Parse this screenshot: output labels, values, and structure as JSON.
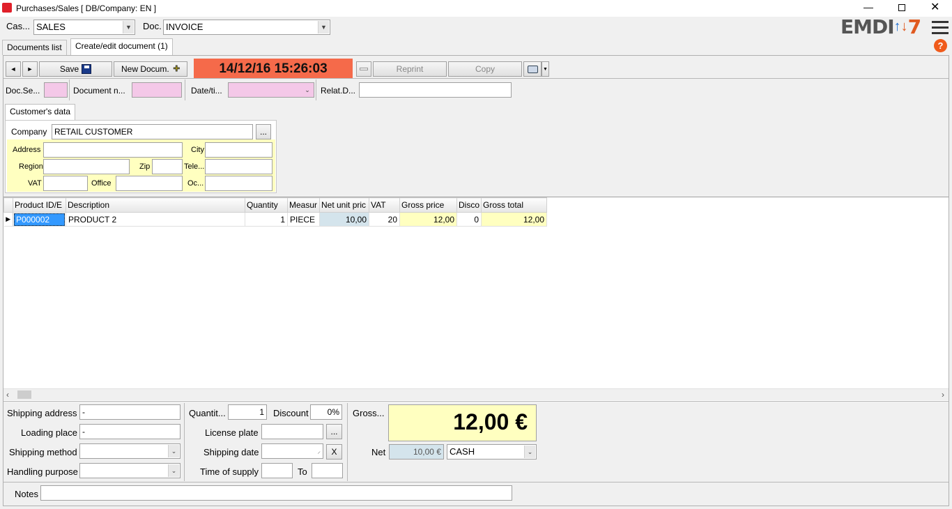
{
  "window": {
    "title": "Purchases/Sales",
    "db_company": "[ DB/Company: EN ]",
    "logo_text": "EMDI",
    "logo_num": "7"
  },
  "top": {
    "cash_label": "Cas...",
    "cash_value": "SALES",
    "doc_label": "Doc.",
    "doc_value": "INVOICE"
  },
  "tabs": [
    {
      "label": "Documents list"
    },
    {
      "label": "Create/edit document (1)"
    }
  ],
  "toolbar": {
    "prev": "◄",
    "next": "►",
    "save_label": "Save",
    "new_doc_label": "New Docum.",
    "datetime": "14/12/16 15:26:03",
    "reprint_label": "Reprint",
    "copy_label": "Copy"
  },
  "doc_fields": {
    "series_label": "Doc.Se...",
    "number_label": "Document n...",
    "datetime_label": "Date/ti...",
    "related_label": "Relat.D..."
  },
  "customer": {
    "tab_label": "Customer's data",
    "company_label": "Company",
    "company_value": "RETAIL CUSTOMER",
    "browse": "...",
    "address_label": "Address",
    "city_label": "City",
    "region_label": "Region",
    "zip_label": "Zip",
    "tele_label": "Tele...",
    "vat_label": "VAT",
    "office_label": "Office",
    "oc_label": "Oc..."
  },
  "grid": {
    "columns": [
      "Product ID/E",
      "Description",
      "Quantity",
      "Measur",
      "Net unit pric",
      "VAT",
      "Gross price",
      "Disco",
      "Gross total"
    ],
    "rows": [
      {
        "id": "P000002",
        "description": "PRODUCT 2",
        "quantity": "1",
        "measure": "PIECE",
        "net_unit": "10,00",
        "vat": "20",
        "gross_price": "12,00",
        "discount": "0",
        "gross_total": "12,00"
      }
    ]
  },
  "footer": {
    "shipping_address_label": "Shipping address",
    "shipping_address_value": "-",
    "loading_place_label": "Loading place",
    "loading_place_value": "-",
    "shipping_method_label": "Shipping method",
    "handling_purpose_label": "Handling purpose",
    "quantity_label": "Quantit...",
    "quantity_value": "1",
    "discount_label": "Discount",
    "discount_value": "0%",
    "license_plate_label": "License plate",
    "license_browse": "...",
    "shipping_date_label": "Shipping date",
    "shipping_date_clear": "X",
    "time_supply_label": "Time of supply",
    "to_label": "To",
    "gross_label": "Gross...",
    "gross_total": "12,00 €",
    "net_label": "Net",
    "net_value": "10,00 €",
    "payment_value": "CASH",
    "notes_label": "Notes"
  },
  "colors": {
    "datetime_bg": "#f56a4a",
    "pink_field": "#f4c8e8",
    "customer_bg": "#ffffc0",
    "selection": "#3399ff"
  }
}
